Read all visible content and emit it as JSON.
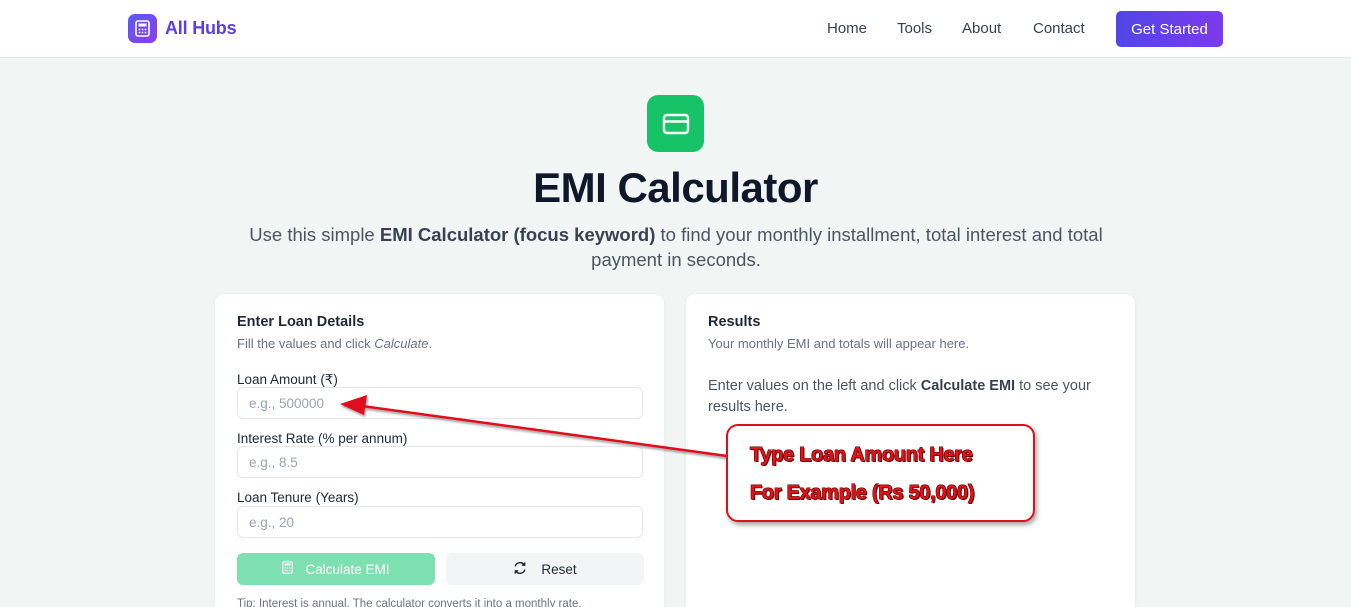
{
  "header": {
    "brand": "All Hubs",
    "nav": [
      "Home",
      "Tools",
      "About",
      "Contact"
    ],
    "cta": "Get Started"
  },
  "hero": {
    "icon": "credit-card-icon",
    "title": "EMI Calculator",
    "subtitle_prefix": "Use this simple ",
    "subtitle_bold": "EMI Calculator (focus keyword)",
    "subtitle_suffix": " to find your monthly installment, total interest and total payment in seconds."
  },
  "form": {
    "title": "Enter Loan Details",
    "subtitle_prefix": "Fill the values and click ",
    "subtitle_em": "Calculate",
    "subtitle_suffix": ".",
    "loan_amount_label": "Loan Amount (₹)",
    "loan_amount_placeholder": "e.g., 500000",
    "loan_amount_value": "",
    "interest_label": "Interest Rate (% per annum)",
    "interest_placeholder": "e.g., 8.5",
    "interest_value": "",
    "tenure_label": "Loan Tenure (Years)",
    "tenure_placeholder": "e.g., 20",
    "tenure_value": "",
    "calculate_label": "Calculate EMI",
    "reset_label": "Reset",
    "tip": "Tip: Interest is annual. The calculator converts it into a monthly rate."
  },
  "results": {
    "title": "Results",
    "subtitle": "Your monthly EMI and totals will appear here.",
    "body_prefix": "Enter values on the left and click ",
    "body_bold": "Calculate EMI",
    "body_suffix": " to see your results here."
  },
  "annotation": {
    "line1": "Type Loan Amount Here",
    "line2": "For Example (Rs 50,000)"
  },
  "colors": {
    "brand": "#5b3ee8",
    "cta": "#4f46e5",
    "hero_icon": "#16c467",
    "calc_button": "#7ee0b0",
    "annotation": "#e11218"
  }
}
